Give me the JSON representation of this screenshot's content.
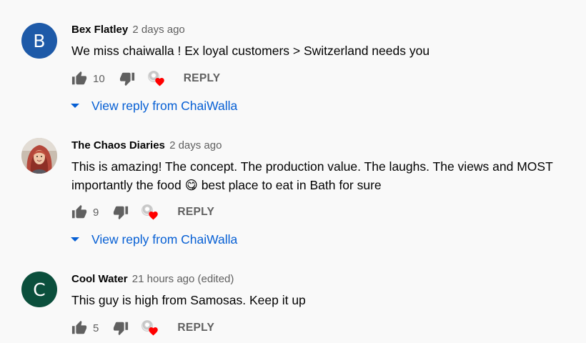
{
  "comments": [
    {
      "author": "Bex Flatley",
      "time": "2 days ago",
      "avatar_letter": "B",
      "avatar_color": "#1e5aa8",
      "text_lines": [
        "We miss chaiwalla ! Ex loyal customers > Switzerland needs you"
      ],
      "likes": "10",
      "reply_label": "REPLY",
      "view_replies": "View reply from ChaiWalla"
    },
    {
      "author": "The Chaos Diaries",
      "time": "2 days ago",
      "avatar_letter": "",
      "avatar_color": "#8a5a4a",
      "text_lines": [
        "This is amazing! The concept. The production value. The laughs. The views and MOST",
        "importantly the food",
        "best place to eat in Bath for sure"
      ],
      "emoji": "😋",
      "likes": "9",
      "reply_label": "REPLY",
      "view_replies": "View reply from ChaiWalla"
    },
    {
      "author": "Cool Water",
      "time": "21 hours ago (edited)",
      "avatar_letter": "C",
      "avatar_color": "#0b4f3c",
      "text_lines": [
        "This guy is high from Samosas. Keep it up"
      ],
      "likes": "5",
      "reply_label": "REPLY"
    }
  ],
  "colors": {
    "link": "#065fd4",
    "heart": "#ff0000",
    "icon": "#606060"
  }
}
